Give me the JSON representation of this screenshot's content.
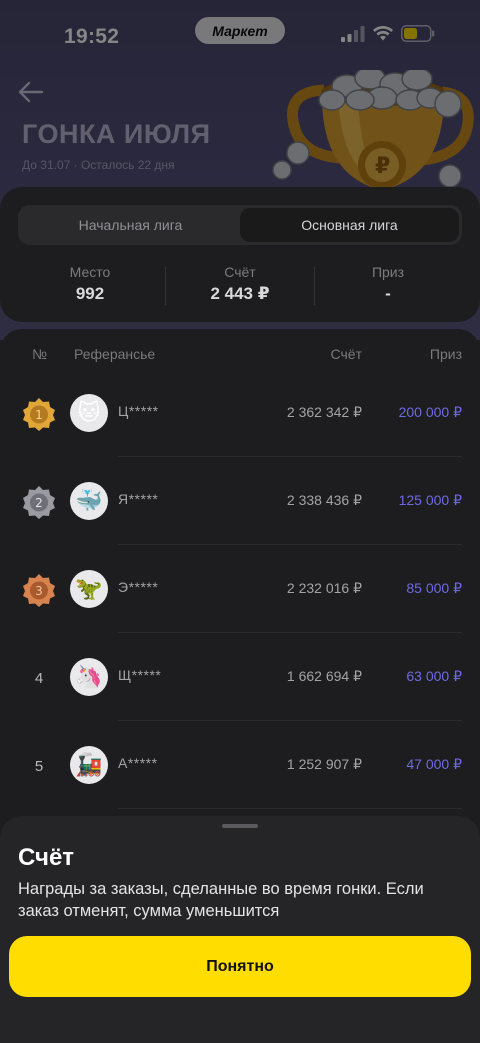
{
  "status_bar": {
    "time": "19:52",
    "app_pill": "Маркет"
  },
  "header": {
    "title": "ГОНКА ИЮЛЯ",
    "subtitle": "До 31.07 · Осталось 22 дня"
  },
  "league_tabs": [
    "Начальная лига",
    "Основная лига"
  ],
  "active_tab": "Основная лига",
  "stats": [
    {
      "label": "Место",
      "value": "992"
    },
    {
      "label": "Счёт",
      "value": "2 443 ₽"
    },
    {
      "label": "Приз",
      "value": "-"
    }
  ],
  "table": {
    "headers": {
      "rank": "№",
      "referral": "Реферансье",
      "score": "Счёт",
      "prize": "Приз"
    },
    "rows": [
      {
        "rank": "1",
        "medal": "gold",
        "avatar": "cat-icon",
        "name": "Ц*****",
        "score": "2 362 342 ₽",
        "prize": "200 000 ₽"
      },
      {
        "rank": "2",
        "medal": "silver",
        "avatar": "whale-icon",
        "name": "Я*****",
        "score": "2 338 436 ₽",
        "prize": "125 000 ₽"
      },
      {
        "rank": "3",
        "medal": "bronze",
        "avatar": "dinosaur-icon",
        "name": "Э*****",
        "score": "2 232 016 ₽",
        "prize": "85 000 ₽"
      },
      {
        "rank": "4",
        "medal": "none",
        "avatar": "unicorn-icon",
        "name": "Щ*****",
        "score": "1 662 694 ₽",
        "prize": "63 000 ₽"
      },
      {
        "rank": "5",
        "medal": "none",
        "avatar": "train-icon",
        "name": "А*****",
        "score": "1 252 907 ₽",
        "prize": "47 000 ₽"
      }
    ]
  },
  "sheet": {
    "title": "Счёт",
    "text": "Награды за заказы, сделанные во время гонки. Если заказ отменят, сумма уменьшится",
    "button": "Понятно"
  },
  "colors": {
    "accent_yellow": "#ffdd00",
    "prize_purple": "#6e6ae0",
    "hero_bg": "#54507a",
    "card_bg": "#1d1d1f",
    "gold": "#e0a63a",
    "silver": "#9a9aa2",
    "bronze": "#d7834f"
  }
}
